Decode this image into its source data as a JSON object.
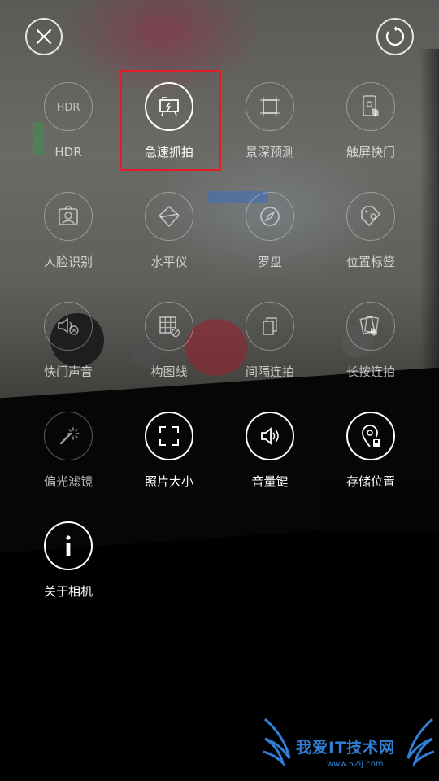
{
  "header": {
    "close_icon": "close-icon",
    "reset_icon": "reset-icon"
  },
  "settings": {
    "items": [
      {
        "label": "HDR",
        "icon": "hdr-icon",
        "icon_text": "HDR",
        "active": false
      },
      {
        "label": "急速抓拍",
        "icon": "quick-snap-icon",
        "active": true
      },
      {
        "label": "景深预测",
        "icon": "depth-of-field-icon",
        "active": false
      },
      {
        "label": "触屏快门",
        "icon": "touch-shutter-icon",
        "active": false
      },
      {
        "label": "人脸识别",
        "icon": "face-detect-icon",
        "active": false
      },
      {
        "label": "水平仪",
        "icon": "level-icon",
        "active": false
      },
      {
        "label": "罗盘",
        "icon": "compass-icon",
        "active": false
      },
      {
        "label": "位置标签",
        "icon": "location-tag-icon",
        "active": false
      },
      {
        "label": "快门声音",
        "icon": "shutter-sound-icon",
        "active": false
      },
      {
        "label": "构图线",
        "icon": "grid-lines-icon",
        "active": false
      },
      {
        "label": "间隔连拍",
        "icon": "interval-burst-icon",
        "active": false
      },
      {
        "label": "长按连拍",
        "icon": "long-press-burst-icon",
        "active": false
      },
      {
        "label": "偏光滤镜",
        "icon": "polarizer-icon",
        "active": false
      },
      {
        "label": "照片大小",
        "icon": "photo-size-icon",
        "active": true
      },
      {
        "label": "音量键",
        "icon": "volume-key-icon",
        "active": true
      },
      {
        "label": "存储位置",
        "icon": "storage-location-icon",
        "active": true
      },
      {
        "label": "关于相机",
        "icon": "info-icon",
        "active": true
      }
    ]
  },
  "watermark": {
    "text": "我爱IT技术网",
    "url": "www.52ij.com"
  },
  "colors": {
    "highlight": "#e51c23",
    "watermark": "#2f7fd6"
  }
}
